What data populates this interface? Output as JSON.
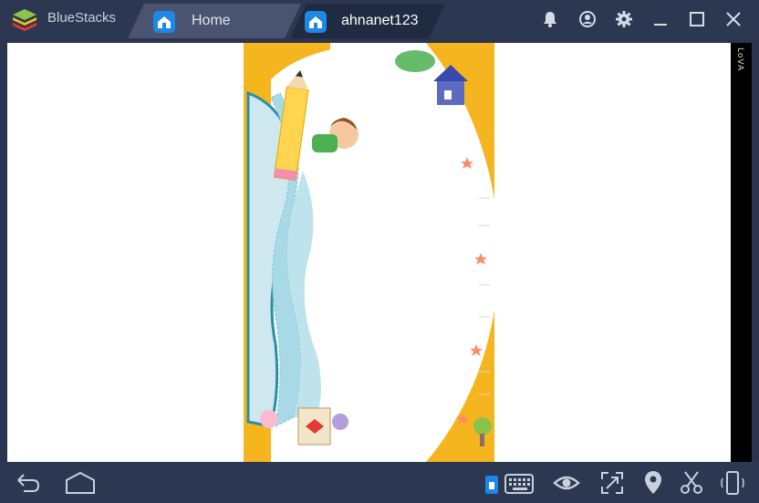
{
  "window": {
    "app_name": "BlueStacks",
    "tabs": [
      {
        "label": "Home",
        "icon": "home-icon",
        "active": false
      },
      {
        "label": "ahnanet123",
        "icon": "home-icon",
        "active": true
      }
    ],
    "controls": [
      "bell-icon",
      "account-icon",
      "gear-icon",
      "minimize-icon",
      "maximize-icon",
      "close-icon"
    ]
  },
  "android_screen": {
    "side_text": "LoVA"
  },
  "bottom_bar": {
    "left": [
      "back-icon",
      "home-icon"
    ],
    "right": [
      "keyboard-icon",
      "eye-icon",
      "fullscreen-icon",
      "location-icon",
      "scissors-icon",
      "rotate-icon"
    ]
  },
  "colors": {
    "titlebar": "#2c3752",
    "active_tab": "#202a40",
    "accent": "#1e88e5",
    "game_bg": "#f5b51f"
  }
}
